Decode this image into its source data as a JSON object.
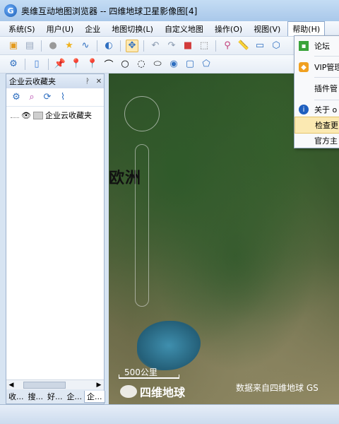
{
  "window": {
    "title": "奥维互动地图浏览器 -- 四维地球卫星影像图[4]"
  },
  "menu": {
    "items": [
      "系统(S)",
      "用户(U)",
      "企业",
      "地图切换(L)",
      "自定义地图",
      "操作(O)",
      "视图(V)",
      "帮助(H)"
    ]
  },
  "help_menu": {
    "items": [
      "论坛",
      "VIP管理",
      "插件管",
      "关于 o",
      "检查更",
      "官方主"
    ]
  },
  "panel": {
    "title": "企业云收藏夹",
    "tree_root": "企业云收藏夹",
    "tabs": [
      "收...",
      "搜...",
      "好...",
      "企...",
      "企..."
    ]
  },
  "map": {
    "continent_label": "欧洲",
    "scale_text": "500公里",
    "logo_text": "四维地球",
    "attribution": "数据来自四维地球 GS"
  },
  "colors": {
    "accent": "#1a5bb0",
    "hover": "#fbe9b2"
  }
}
